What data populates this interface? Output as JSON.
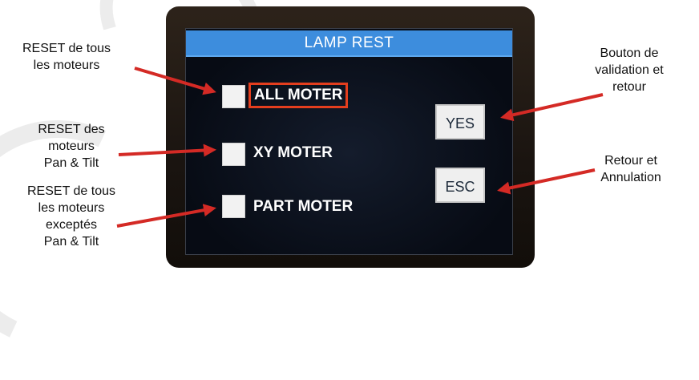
{
  "screen": {
    "title": "LAMP REST",
    "options": [
      {
        "label": "ALL MOTER",
        "selected": true
      },
      {
        "label": "XY MOTER",
        "selected": false
      },
      {
        "label": "PART MOTER",
        "selected": false
      }
    ],
    "buttons": {
      "yes": "YES",
      "esc": "ESC"
    }
  },
  "annotations": {
    "reset_all": "RESET de tous\nles moteurs",
    "reset_pan_tilt": "RESET des\nmoteurs\nPan & Tilt",
    "reset_except": "RESET de tous\nles moteurs\nexceptés\nPan & Tilt",
    "validate_return": "Bouton de\nvalidation et\nretour",
    "return_cancel": "Retour et\nAnnulation"
  },
  "colors": {
    "title_bar": "#3d8ddd",
    "selection_border": "#e43e1e",
    "arrow": "#d42a25"
  }
}
